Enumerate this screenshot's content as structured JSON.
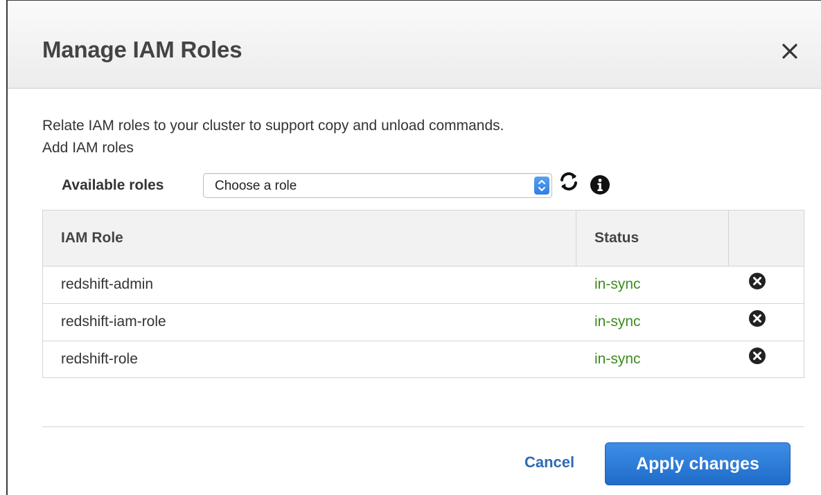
{
  "dialog": {
    "title": "Manage IAM Roles",
    "description": "Relate IAM roles to your cluster to support copy and unload commands.",
    "add_label": "Add IAM roles"
  },
  "roles_selector": {
    "label": "Available roles",
    "selected": "Choose a role"
  },
  "table": {
    "headers": {
      "role": "IAM Role",
      "status": "Status",
      "action": ""
    },
    "rows": [
      {
        "role": "redshift-admin",
        "status": "in-sync"
      },
      {
        "role": "redshift-iam-role",
        "status": "in-sync"
      },
      {
        "role": "redshift-role",
        "status": "in-sync"
      }
    ]
  },
  "footer": {
    "cancel_label": "Cancel",
    "apply_label": "Apply changes"
  },
  "colors": {
    "status_ok": "#3d8b1e",
    "primary": "#1f6cc9",
    "link": "#2f6bb3"
  },
  "icons": [
    "close-icon",
    "refresh-icon",
    "info-icon",
    "remove-icon",
    "select-arrow-icon"
  ]
}
